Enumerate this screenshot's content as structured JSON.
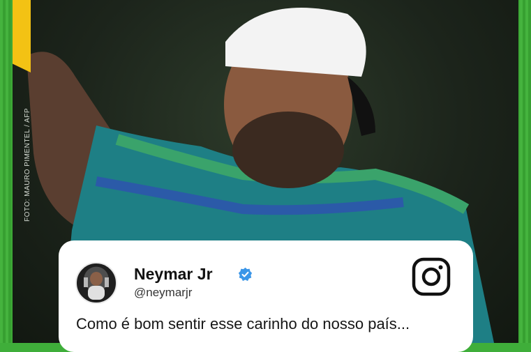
{
  "post": {
    "credit": "FOTO: MAURO PIMENTEL / AFP",
    "name": "Neymar Jr",
    "handle": "@neymarjr",
    "text": "Como é bom sentir esse carinho do nosso país..."
  },
  "icons": [
    "verified-icon",
    "instagram-icon",
    "avatar-icon"
  ],
  "colors": {
    "background": "#3da936",
    "flag": "#f3c214",
    "verified": "#3b96e8"
  }
}
